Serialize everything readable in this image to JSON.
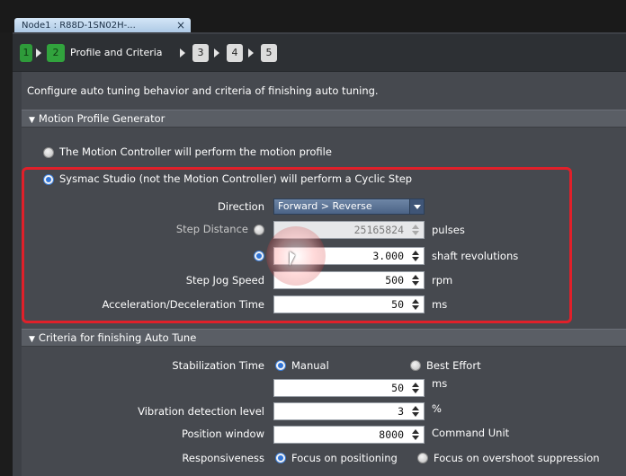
{
  "tab": {
    "title": "Node1 : R88D-1SN02H-...",
    "close": "×"
  },
  "steps": [
    {
      "number": "1",
      "state": "done"
    },
    {
      "number": "2",
      "state": "active",
      "title": "Profile and Criteria"
    },
    {
      "number": "3",
      "state": "todo"
    },
    {
      "number": "4",
      "state": "todo"
    },
    {
      "number": "5",
      "state": "todo"
    }
  ],
  "intro": "Configure auto tuning behavior and criteria of finishing auto tuning.",
  "motion_profile": {
    "header": "Motion Profile Generator",
    "option_controller": "The Motion Controller will perform the motion profile",
    "option_sysmac": "Sysmac Studio (not the Motion Controller) will perform a Cyclic Step",
    "selected": "sysmac",
    "direction": {
      "label": "Direction",
      "value": "Forward > Reverse"
    },
    "step_distance": {
      "label": "Step Distance",
      "pulses_value": "25165824",
      "pulses_unit": "pulses",
      "revolutions_value": "3.000",
      "revolutions_unit": "shaft revolutions",
      "selected": "revolutions"
    },
    "jog_speed": {
      "label": "Step Jog Speed",
      "value": "500",
      "unit": "rpm"
    },
    "accel_time": {
      "label": "Acceleration/Deceleration Time",
      "value": "50",
      "unit": "ms"
    }
  },
  "criteria": {
    "header": "Criteria for finishing Auto Tune",
    "stabilization": {
      "label": "Stabilization Time",
      "option_manual": "Manual",
      "option_best": "Best Effort",
      "selected": "manual",
      "value": "50",
      "unit": "ms"
    },
    "vibration": {
      "label": "Vibration detection level",
      "value": "3",
      "unit": "%"
    },
    "position_window": {
      "label": "Position window",
      "value": "8000",
      "unit": "Command Unit"
    },
    "responsiveness": {
      "label": "Responsiveness",
      "option_positioning": "Focus on positioning",
      "option_overshoot": "Focus on overshoot suppression",
      "selected": "positioning"
    }
  },
  "colors": {
    "highlight": "#e0202a",
    "step_active": "#31a33d",
    "radio_selected": "#2f74d8"
  }
}
